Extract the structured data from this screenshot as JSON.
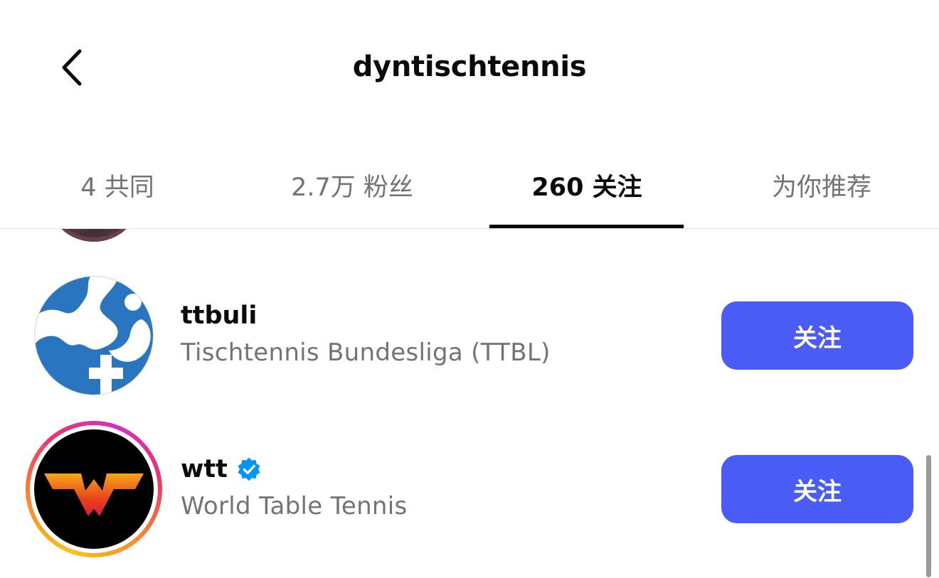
{
  "header": {
    "title": "dyntischtennis"
  },
  "tabs": [
    {
      "label": "4 共同"
    },
    {
      "label": "2.7万 粉丝"
    },
    {
      "label": "260 关注",
      "active": true
    },
    {
      "label": "为你推荐"
    }
  ],
  "list": [
    {
      "username": "ttbuli",
      "full_name": "Tischtennis Bundesliga (TTBL)",
      "verified": false,
      "button_label": "关注",
      "avatar_icon": "ttbl-logo-icon"
    },
    {
      "username": "wtt",
      "full_name": "World Table Tennis",
      "verified": true,
      "button_label": "关注",
      "avatar_icon": "wtt-logo-icon"
    }
  ],
  "colors": {
    "follow_button": "#4a5cf6",
    "verified_badge": "#0095f6",
    "ttbl_blue": "#2a75bf",
    "story_ring_start": "#f9c21b",
    "story_ring_end": "#d62fc0"
  }
}
